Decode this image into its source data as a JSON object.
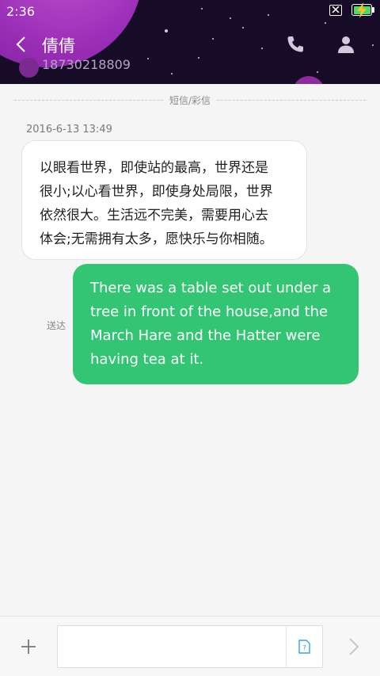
{
  "status_bar": {
    "time": "2:36"
  },
  "header": {
    "contact_name": "倩倩",
    "contact_number": "18730218809"
  },
  "conversation": {
    "divider_label": "短信/彩信",
    "timestamp": "2016-6-13 13:49",
    "messages": [
      {
        "direction": "incoming",
        "lines": [
          "以眼看世界，即使站的最高，世界还是",
          "很小;以心看世界，即使身处局限，世界",
          "依然很大。生活远不完美，需要用心去",
          "体会;无需拥有太多，愿快乐与你相随。"
        ]
      },
      {
        "direction": "outgoing",
        "status": "送达",
        "lines": [
          "There was a table set out under a",
          "tree in front of the house,and the",
          "March Hare and the Hatter were",
          "having tea at it."
        ]
      }
    ]
  },
  "composer": {
    "input_value": "",
    "placeholder": ""
  },
  "colors": {
    "header_bg": "#170c27",
    "planet": "#9c2fb8",
    "outgoing_bubble": "#33c474",
    "incoming_bubble": "#ffffff",
    "battery": "#4cd964"
  },
  "icons": [
    "back-icon",
    "phone-icon",
    "person-icon",
    "sim-card-icon",
    "battery-icon",
    "add-icon",
    "sim-select-icon",
    "send-icon"
  ]
}
